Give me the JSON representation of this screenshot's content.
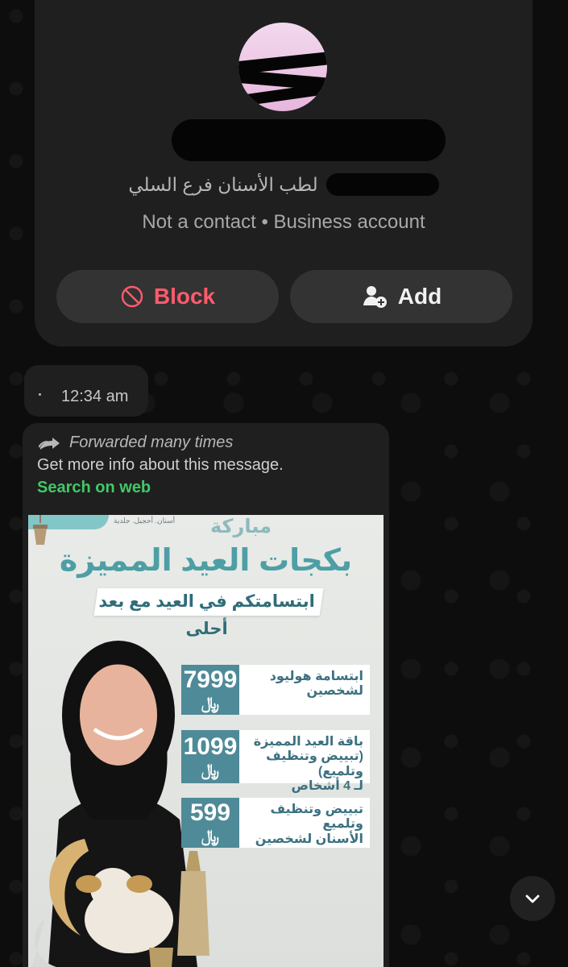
{
  "contact": {
    "business_line_visible": "لطب الأسنان فرع السلي",
    "status": "Not a contact • Business account",
    "buttons": {
      "block": "Block",
      "add": "Add"
    }
  },
  "timestamp_bubble": {
    "time": "12:34 am"
  },
  "message": {
    "forwarded_label": "Forwarded many times",
    "info_text": "Get more info about this message.",
    "search_link": "Search on web",
    "poster": {
      "top_small_text": "أسنان. أحجيل. جلدية",
      "top_script": "مباركة",
      "title": "بكجات العيد المميزة",
      "subtitle": "ابتسامتكم في العيد مع بعد أحلى",
      "offers": [
        {
          "price": "7999",
          "currency": "﷼",
          "line1": "ابتسامة هوليود",
          "line2": "لشخصين"
        },
        {
          "price": "1099",
          "currency": "﷼",
          "line1": "باقة العيد المميزة",
          "line2": "(تبييض وتنظيف وتلميع)",
          "line3": "لـ 4 أشخاص"
        },
        {
          "price": "599",
          "currency": "﷼",
          "line1": "تبييض وتنظيف وتلميع",
          "line2": "الأسنان لشخصين"
        }
      ]
    }
  },
  "colors": {
    "background": "#0b0b0b",
    "card": "#1f1f1f",
    "button": "#333333",
    "block_red": "#ff5b6d",
    "link_green": "#42c867",
    "poster_teal": "#4f8a98"
  },
  "icons": {
    "block": "block-icon",
    "add": "add-user-icon",
    "forwarded": "double-arrow-forward-icon",
    "scroll": "chevron-down-icon"
  }
}
